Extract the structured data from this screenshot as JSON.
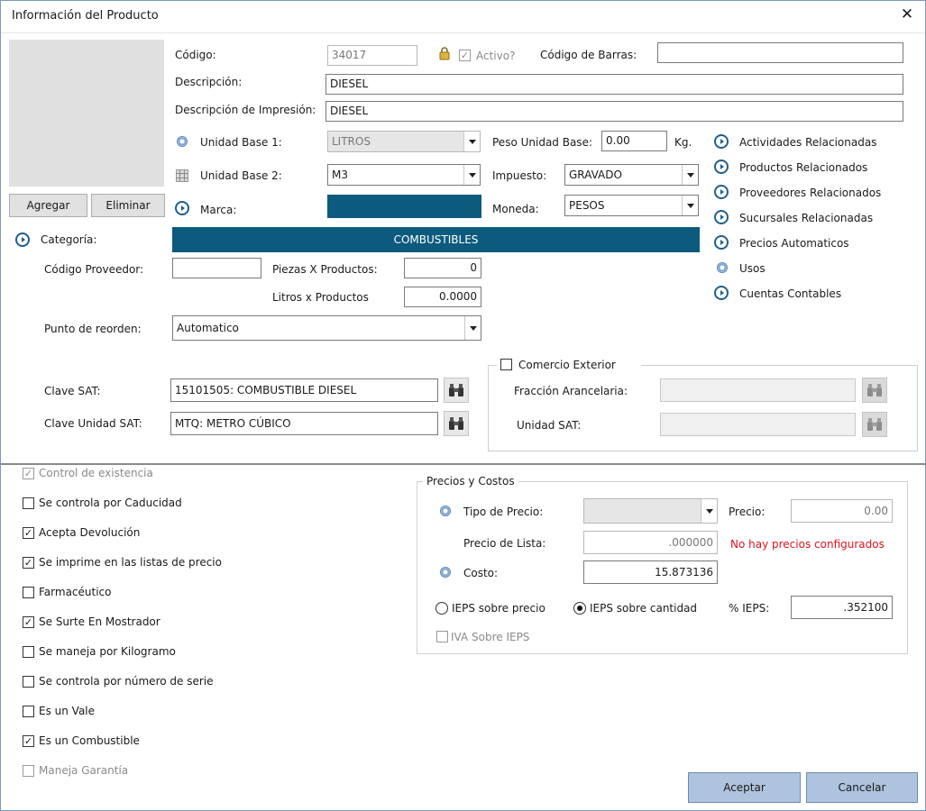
{
  "window": {
    "title": "Información del Producto",
    "close_glyph": "✕"
  },
  "product": {
    "codigo_label": "Código:",
    "codigo_value": "34017",
    "activo_label": "Activo?",
    "barcode_label": "Código de Barras:",
    "barcode_value": "",
    "descripcion_label": "Descripción:",
    "descripcion_value": "DIESEL",
    "desc_impresion_label": "Descripción de Impresión:",
    "desc_impresion_value": "DIESEL",
    "unidad1_label": "Unidad Base 1:",
    "unidad1_value": "LITROS",
    "unidad2_label": "Unidad Base 2:",
    "unidad2_value": "M3",
    "peso_label": "Peso Unidad Base:",
    "peso_value": "0.00",
    "peso_unit": "Kg.",
    "impuesto_label": "Impuesto:",
    "impuesto_value": "GRAVADO",
    "moneda_label": "Moneda:",
    "moneda_value": "PESOS",
    "marca_label": "Marca:",
    "categoria_label": "Categoría:",
    "categoria_value": "COMBUSTIBLES",
    "codigo_prov_label": "Código Proveedor:",
    "codigo_prov_value": "",
    "piezas_label": "Piezas X Productos:",
    "piezas_value": "0",
    "litros_label": "Litros x Productos",
    "litros_value": "0.0000",
    "reorden_label": "Punto de reorden:",
    "reorden_value": "Automatico",
    "clave_sat_label": "Clave SAT:",
    "clave_sat_value": "15101505: COMBUSTIBLE DIESEL",
    "clave_unidad_label": "Clave Unidad SAT:",
    "clave_unidad_value": "MTQ: METRO CÚBICO"
  },
  "image_buttons": {
    "add": "Agregar",
    "remove": "Eliminar"
  },
  "links": [
    "Actividades Relacionadas",
    "Productos Relacionados",
    "Proveedores Relacionados",
    "Sucursales Relacionadas",
    "Precios Automaticos",
    "Usos",
    "Cuentas Contables"
  ],
  "comercio": {
    "legend": "Comercio Exterior",
    "fraccion_label": "Fracción Arancelaria:",
    "unidad_label": "Unidad SAT:"
  },
  "options": [
    {
      "label": "Control de existencia",
      "checked": true,
      "disabled": true
    },
    {
      "label": "Se controla por Caducidad",
      "checked": false,
      "disabled": false
    },
    {
      "label": "Acepta Devolución",
      "checked": true,
      "disabled": false
    },
    {
      "label": "Se imprime en las listas de precio",
      "checked": true,
      "disabled": false
    },
    {
      "label": "Farmacéutico",
      "checked": false,
      "disabled": false
    },
    {
      "label": "Se Surte En Mostrador",
      "checked": true,
      "disabled": false
    },
    {
      "label": "Se maneja por Kilogramo",
      "checked": false,
      "disabled": false
    },
    {
      "label": "Se controla por número de serie",
      "checked": false,
      "disabled": false
    },
    {
      "label": "Es un Vale",
      "checked": false,
      "disabled": false
    },
    {
      "label": "Es un Combustible",
      "checked": true,
      "disabled": false
    },
    {
      "label": "Maneja Garantía",
      "checked": false,
      "disabled": true
    }
  ],
  "precios": {
    "legend": "Precios y Costos",
    "tipo_label": "Tipo de Precio:",
    "tipo_value": "",
    "precio_label": "Precio:",
    "precio_value": "0.00",
    "lista_label": "Precio de Lista:",
    "lista_value": ".000000",
    "warning": "No hay precios configurados",
    "costo_label": "Costo:",
    "costo_value": "15.873136",
    "ieps_precio_label": "IEPS sobre precio",
    "ieps_cantidad_label": "IEPS sobre cantidad",
    "ieps_pct_label": "% IEPS:",
    "ieps_pct_value": ".352100",
    "iva_label": "IVA Sobre IEPS"
  },
  "footer": {
    "accept": "Aceptar",
    "cancel": "Cancelar"
  },
  "colors": {
    "accent_bar": "#0c5a7e",
    "link_icon": "#1f5f8b",
    "warning": "#e0141e",
    "button_blue": "#aec4de"
  }
}
